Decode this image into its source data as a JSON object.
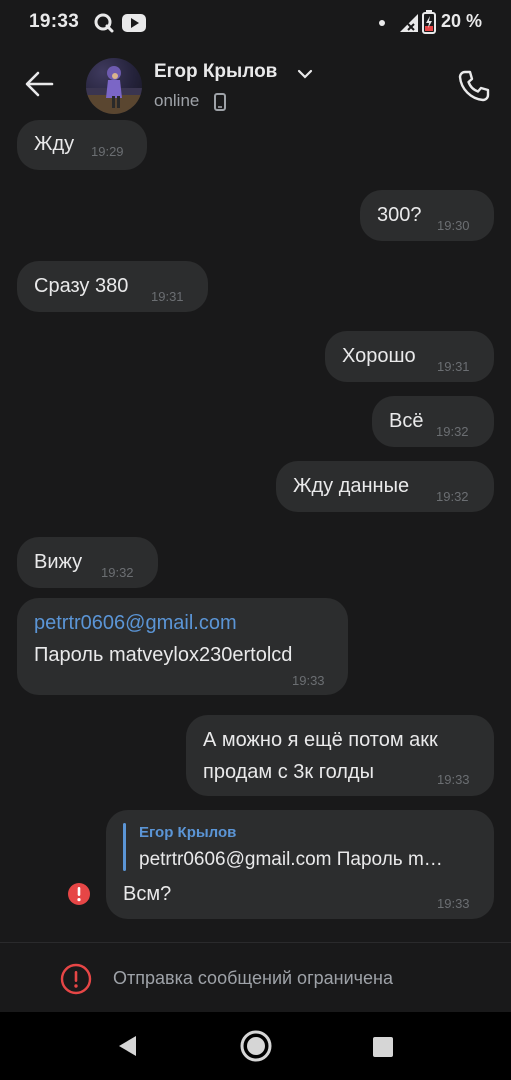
{
  "status_bar": {
    "time": "19:33",
    "icons": [
      "q-app-icon",
      "youtube-icon",
      "notification-dot-icon",
      "signal-icon",
      "battery-icon"
    ],
    "battery": "20 %"
  },
  "header": {
    "name": "Егор Крылов",
    "status": "online",
    "icons": [
      "back-arrow-icon",
      "chevron-down-icon",
      "mobile-device-icon",
      "phone-call-icon"
    ]
  },
  "messages": [
    {
      "side": "in",
      "text": "Жду",
      "time": "19:29"
    },
    {
      "side": "out",
      "text": "300?",
      "time": "19:30"
    },
    {
      "side": "in",
      "text": "Сразу 380",
      "time": "19:31"
    },
    {
      "side": "out",
      "text": "Хорошо",
      "time": "19:31"
    },
    {
      "side": "out",
      "text": "Всё",
      "time": "19:32"
    },
    {
      "side": "out",
      "text": "Жду данные",
      "time": "19:32"
    },
    {
      "side": "in",
      "text": "Вижу",
      "time": "19:32"
    },
    {
      "side": "in",
      "link": "petrtr0606@gmail.com",
      "text": "Пароль matveylox230ertolcd",
      "time": "19:33"
    },
    {
      "side": "out",
      "lines": [
        "А можно я ещё потом акк",
        "продам с 3к голды"
      ],
      "time": "19:33"
    },
    {
      "side": "out",
      "reply_author": "Егор Крылов",
      "reply_text": "petrtr0606@gmail.com Пароль m…",
      "text": "Всм?",
      "time": "19:33",
      "error": true
    }
  ],
  "bottom": {
    "text": "Отправка сообщений ограничена",
    "accent": "#e64646"
  },
  "colors": {
    "background": "#19191a",
    "bubble": "#2c2d2e",
    "link": "#5b95d6",
    "error": "#e64646"
  }
}
